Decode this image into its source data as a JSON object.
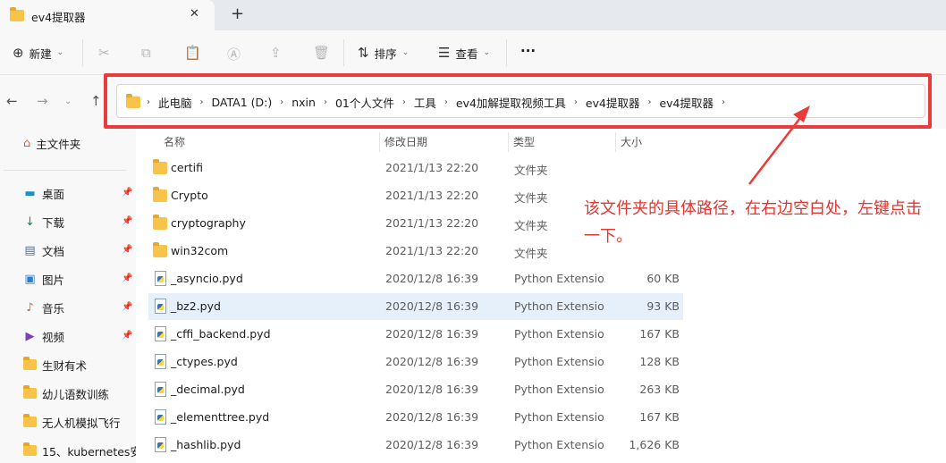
{
  "window": {
    "tab_title": "ev4提取器",
    "close_glyph": "✕",
    "new_tab_glyph": "+"
  },
  "toolbar": {
    "new_label": "新建",
    "sort_label": "排序",
    "view_label": "查看",
    "more_label": "···"
  },
  "breadcrumb": [
    "此电脑",
    "DATA1 (D:)",
    "nxin",
    "01个人文件",
    "工具",
    "ev4加解提取视频工具",
    "ev4提取器",
    "ev4提取器"
  ],
  "sidebar": {
    "home": "主文件夹",
    "items": [
      {
        "label": "桌面",
        "icon": "desktop-icon",
        "pinned": true
      },
      {
        "label": "下载",
        "icon": "download-icon",
        "pinned": true
      },
      {
        "label": "文档",
        "icon": "document-icon",
        "pinned": true
      },
      {
        "label": "图片",
        "icon": "picture-icon",
        "pinned": true
      },
      {
        "label": "音乐",
        "icon": "music-icon",
        "pinned": true
      },
      {
        "label": "视频",
        "icon": "video-icon",
        "pinned": true
      },
      {
        "label": "生财有术",
        "icon": "folder-icon",
        "pinned": false
      },
      {
        "label": "幼儿语数训练",
        "icon": "folder-icon",
        "pinned": false
      },
      {
        "label": "无人机模拟飞行",
        "icon": "folder-icon",
        "pinned": false
      },
      {
        "label": "15、kubernetes安",
        "icon": "folder-icon",
        "pinned": false
      }
    ]
  },
  "columns": {
    "name": "名称",
    "date": "修改日期",
    "type": "类型",
    "size": "大小"
  },
  "files": [
    {
      "name": "certifi",
      "date": "2021/1/13 22:20",
      "type": "文件夹",
      "size": "",
      "kind": "folder"
    },
    {
      "name": "Crypto",
      "date": "2021/1/13 22:20",
      "type": "文件夹",
      "size": "",
      "kind": "folder"
    },
    {
      "name": "cryptography",
      "date": "2021/1/13 22:20",
      "type": "文件夹",
      "size": "",
      "kind": "folder"
    },
    {
      "name": "win32com",
      "date": "2021/1/13 22:20",
      "type": "文件夹",
      "size": "",
      "kind": "folder"
    },
    {
      "name": "_asyncio.pyd",
      "date": "2020/12/8 16:39",
      "type": "Python Extensio...",
      "size": "60 KB",
      "kind": "pyd"
    },
    {
      "name": "_bz2.pyd",
      "date": "2020/12/8 16:39",
      "type": "Python Extensio...",
      "size": "93 KB",
      "kind": "pyd",
      "selected": true
    },
    {
      "name": "_cffi_backend.pyd",
      "date": "2020/12/8 16:39",
      "type": "Python Extensio...",
      "size": "167 KB",
      "kind": "pyd"
    },
    {
      "name": "_ctypes.pyd",
      "date": "2020/12/8 16:39",
      "type": "Python Extensio...",
      "size": "128 KB",
      "kind": "pyd"
    },
    {
      "name": "_decimal.pyd",
      "date": "2020/12/8 16:39",
      "type": "Python Extensio...",
      "size": "263 KB",
      "kind": "pyd"
    },
    {
      "name": "_elementtree.pyd",
      "date": "2020/12/8 16:39",
      "type": "Python Extensio...",
      "size": "167 KB",
      "kind": "pyd"
    },
    {
      "name": "_hashlib.pyd",
      "date": "2020/12/8 16:39",
      "type": "Python Extensio...",
      "size": "1,626 KB",
      "kind": "pyd"
    }
  ],
  "annotation": {
    "text": "该文件夹的具体路径，在右边空白处，左键点击一下。",
    "color": "#e2352f"
  },
  "colors": {
    "accent_red": "#e83c3c",
    "selection": "#e5f0fb",
    "folder": "#f7c34a"
  }
}
